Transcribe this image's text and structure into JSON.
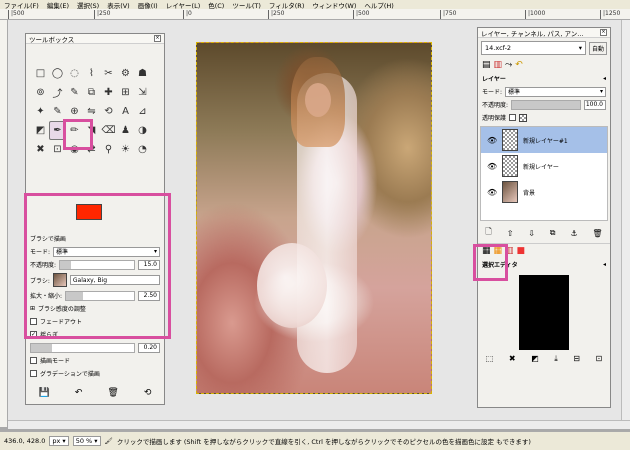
{
  "menubar": {
    "items": [
      "ファイル(F)",
      "編集(E)",
      "選択(S)",
      "表示(V)",
      "画像(I)",
      "レイヤー(L)",
      "色(C)",
      "ツール(T)",
      "フィルタ(R)",
      "ウィンドウ(W)",
      "ヘルプ(H)"
    ]
  },
  "ruler": {
    "ticks": [
      "|500",
      "|250",
      "|0",
      "|250",
      "|500",
      "|750",
      "|1000",
      "|1250"
    ]
  },
  "toolbox": {
    "title": "ツールボックス",
    "tools": [
      "□",
      "◯",
      "◌",
      "⌇",
      "✂",
      "⚙",
      "☗",
      "⊚",
      "⤴",
      "✎",
      "⧉",
      "✚",
      "⊞",
      "⇲",
      "✦",
      "✎",
      "⊕",
      "⇋",
      "⟲",
      "A",
      "⊿",
      "◩",
      "✒",
      "✏",
      "◥",
      "⌫",
      "♟",
      "◑",
      "✖",
      "⊡",
      "◉",
      "⇄",
      "⚲",
      "☀",
      "◔"
    ],
    "brush_options": {
      "title": "ブラシで描画",
      "mode_label": "モード:",
      "mode_value": "標準",
      "opacity_label": "不透明度:",
      "opacity_value": "15.0",
      "brush_label": "ブラシ:",
      "brush_value": "Galaxy, Big",
      "scale_label": "拡大・縮小:",
      "scale_value": "2.50",
      "dynamics_label": "ブラシ感度の調整",
      "fade_label": "フェードアウト",
      "jitter_label": "揺らぎ",
      "jitter_value": "0.20",
      "incremental_label": "描画モード",
      "gradient_label": "グラデーションで描画"
    }
  },
  "layers": {
    "title": "レイヤー, チャンネル, パス, アン...",
    "image_combo": "14.xcf-2",
    "auto_label": "自動",
    "panel_title": "レイヤー",
    "mode_label": "モード:",
    "mode_value": "標準",
    "opacity_label": "不透明度:",
    "opacity_value": "100.0",
    "lock_label": "透明保護",
    "items": [
      {
        "name": "新規レイヤー#1"
      },
      {
        "name": "新規レイヤー"
      },
      {
        "name": "背景"
      }
    ],
    "editor_title": "選択エディタ"
  },
  "status": {
    "coords": "436.0, 428.0",
    "unit": "px",
    "zoom": "50 %",
    "message": "クリックで描画します (Shift を押しながらクリックで直線を引く, Ctrl を押しながらクリックでそのピクセルの色を描画色に設定 もできます)"
  },
  "colors": {
    "fg": "#ff2600",
    "bg": "#ffffff",
    "highlight": "#d84f9f",
    "selection": "#a5c0e8"
  }
}
